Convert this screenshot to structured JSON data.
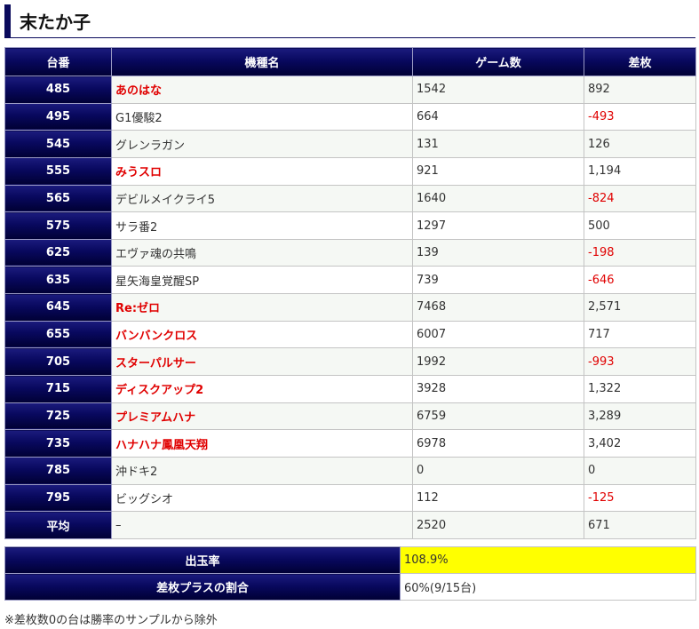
{
  "page": {
    "title": "末たか子"
  },
  "colors": {
    "header_bg": "#08085e",
    "accent_red": "#e00000",
    "highlight_yellow": "#ffff00"
  },
  "chart_data": {
    "type": "table",
    "headers": [
      "台番",
      "機種名",
      "ゲーム数",
      "差枚"
    ],
    "rows": [
      {
        "no": "485",
        "name": "あのはな",
        "games": "1542",
        "diff": "892",
        "name_red": true,
        "diff_red": false
      },
      {
        "no": "495",
        "name": "G1優駿2",
        "games": "664",
        "diff": "-493",
        "name_red": false,
        "diff_red": true
      },
      {
        "no": "545",
        "name": "グレンラガン",
        "games": "131",
        "diff": "126",
        "name_red": false,
        "diff_red": false
      },
      {
        "no": "555",
        "name": "みうスロ",
        "games": "921",
        "diff": "1,194",
        "name_red": true,
        "diff_red": false
      },
      {
        "no": "565",
        "name": "デビルメイクライ5",
        "games": "1640",
        "diff": "-824",
        "name_red": false,
        "diff_red": true
      },
      {
        "no": "575",
        "name": "サラ番2",
        "games": "1297",
        "diff": "500",
        "name_red": false,
        "diff_red": false
      },
      {
        "no": "625",
        "name": "エヴァ魂の共鳴",
        "games": "139",
        "diff": "-198",
        "name_red": false,
        "diff_red": true
      },
      {
        "no": "635",
        "name": "星矢海皇覚醒SP",
        "games": "739",
        "diff": "-646",
        "name_red": false,
        "diff_red": true
      },
      {
        "no": "645",
        "name": "Re:ゼロ",
        "games": "7468",
        "diff": "2,571",
        "name_red": true,
        "diff_red": false
      },
      {
        "no": "655",
        "name": "バンバンクロス",
        "games": "6007",
        "diff": "717",
        "name_red": true,
        "diff_red": false
      },
      {
        "no": "705",
        "name": "スターパルサー",
        "games": "1992",
        "diff": "-993",
        "name_red": true,
        "diff_red": true
      },
      {
        "no": "715",
        "name": "ディスクアップ2",
        "games": "3928",
        "diff": "1,322",
        "name_red": true,
        "diff_red": false
      },
      {
        "no": "725",
        "name": "プレミアムハナ",
        "games": "6759",
        "diff": "3,289",
        "name_red": true,
        "diff_red": false
      },
      {
        "no": "735",
        "name": "ハナハナ鳳凰天翔",
        "games": "6978",
        "diff": "3,402",
        "name_red": true,
        "diff_red": false
      },
      {
        "no": "785",
        "name": "沖ドキ2",
        "games": "0",
        "diff": "0",
        "name_red": false,
        "diff_red": false
      },
      {
        "no": "795",
        "name": "ビッグシオ",
        "games": "112",
        "diff": "-125",
        "name_red": false,
        "diff_red": true
      }
    ],
    "average": {
      "label": "平均",
      "name": "–",
      "games": "2520",
      "diff": "671"
    }
  },
  "summary": {
    "payout_label": "出玉率",
    "payout_value": "108.9%",
    "plus_ratio_label": "差枚プラスの割合",
    "plus_ratio_value": "60%(9/15台)"
  },
  "note": "※差枚数0の台は勝率のサンプルから除外"
}
